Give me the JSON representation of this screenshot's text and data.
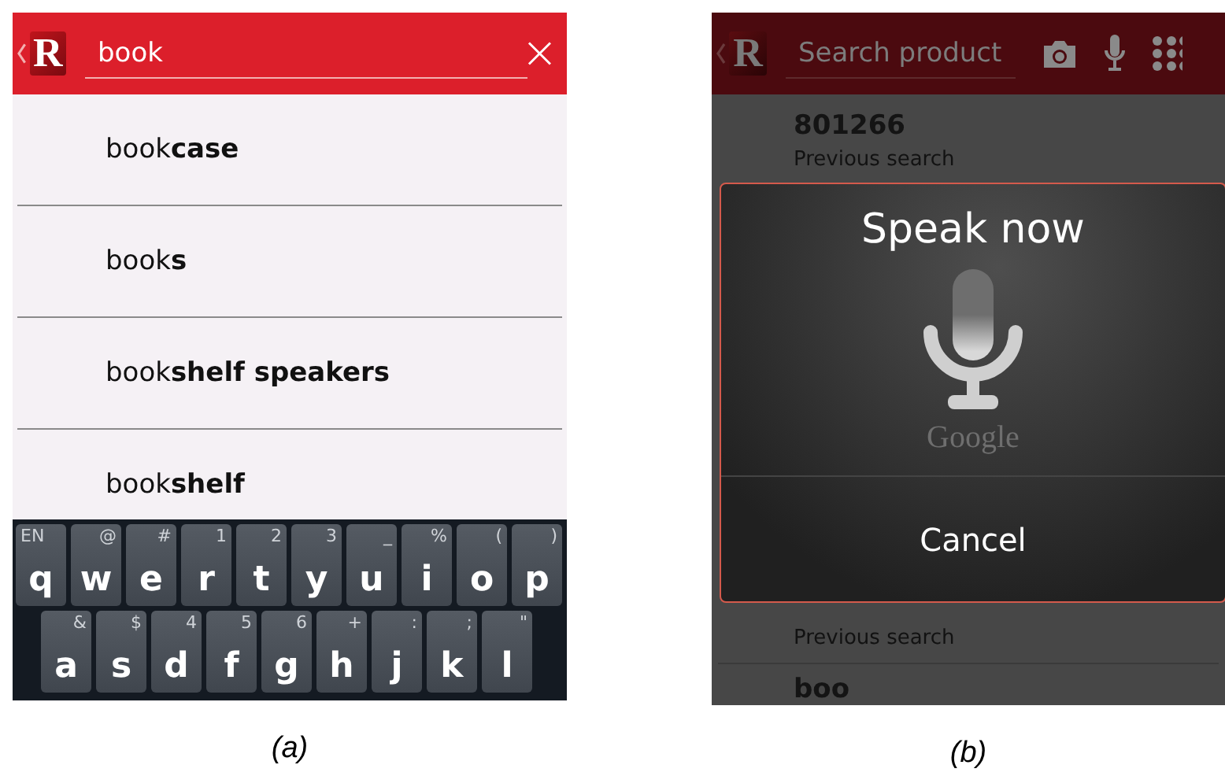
{
  "screen_a": {
    "caption": "(a)",
    "logo": "R",
    "search": {
      "value": "book"
    },
    "suggestions": [
      "book**case**",
      "book**s**",
      "book**shelf speakers**",
      "book**shelf**"
    ],
    "keyboard": [
      [
        {
          "key": "q",
          "alt": "EN"
        },
        {
          "key": "w",
          "alt": "@"
        },
        {
          "key": "e",
          "alt": "#"
        },
        {
          "key": "r",
          "alt": "1"
        },
        {
          "key": "t",
          "alt": "2"
        },
        {
          "key": "y",
          "alt": "3"
        },
        {
          "key": "u",
          "alt": "_"
        },
        {
          "key": "i",
          "alt": "%"
        },
        {
          "key": "o",
          "alt": "("
        },
        {
          "key": "p",
          "alt": ")"
        }
      ],
      [
        {
          "key": "a",
          "alt": "&"
        },
        {
          "key": "s",
          "alt": "$"
        },
        {
          "key": "d",
          "alt": "4"
        },
        {
          "key": "f",
          "alt": "5"
        },
        {
          "key": "g",
          "alt": "6"
        },
        {
          "key": "h",
          "alt": "+"
        },
        {
          "key": "j",
          "alt": ":"
        },
        {
          "key": "k",
          "alt": ";"
        },
        {
          "key": "l",
          "alt": "\""
        }
      ]
    ]
  },
  "screen_b": {
    "caption": "(b)",
    "logo": "R",
    "search": {
      "placeholder": "Search product"
    },
    "history_top": {
      "title": "801266",
      "subtitle": "Previous search"
    },
    "history_bottom": {
      "subtitle": "Previous search",
      "next_title": "boo"
    },
    "dialog": {
      "title": "Speak now",
      "brand": "Google",
      "button": "Cancel"
    }
  }
}
